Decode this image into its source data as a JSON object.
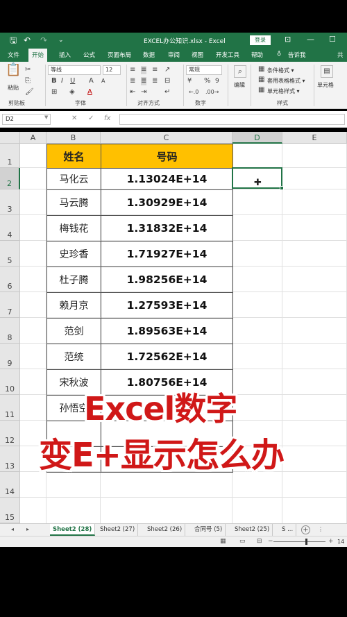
{
  "window": {
    "title": "EXCEL办公知识.xlsx  -  Excel",
    "login_label": "登录",
    "save_glyph": "🖫",
    "undo_glyph": "↶",
    "redo_glyph": "↷",
    "more_glyph": "⌄",
    "min_glyph": "—",
    "max_glyph": "☐",
    "ribbon_opt_glyph": "⊡"
  },
  "tabs": [
    "文件",
    "开始",
    "插入",
    "公式",
    "页面布局",
    "数据",
    "审阅",
    "视图",
    "开发工具",
    "帮助",
    "告诉我",
    "共"
  ],
  "ribbon": {
    "paste_label": "粘贴",
    "clipboard_label": "剪贴板",
    "font_name": "等线",
    "font_size": "12",
    "font_label": "字体",
    "align_label": "对齐方式",
    "number_format": "常规",
    "number_label": "数字",
    "cond_format": "条件格式 ▾",
    "table_format": "套用表格格式 ▾",
    "cell_style": "单元格样式 ▾",
    "styles_label": "样式",
    "edit_label": "编辑",
    "cells_label": "单元格",
    "bold": "B",
    "italic": "I",
    "underline": "U",
    "grow": "A",
    "shrink": "A",
    "fontcolor": "A",
    "percent": "%",
    "comma": "9",
    "currency": "¥"
  },
  "formula_bar": {
    "name_box": "D2",
    "fx": "fx",
    "cancel": "✕",
    "confirm": "✓",
    "formula": ""
  },
  "columns": [
    "A",
    "B",
    "C",
    "D",
    "E"
  ],
  "rows": [
    "1",
    "2",
    "3",
    "4",
    "5",
    "6",
    "7",
    "8",
    "9",
    "10",
    "11",
    "12",
    "13",
    "14",
    "15"
  ],
  "table": {
    "headers": [
      "姓名",
      "号码"
    ],
    "rows": [
      [
        "马化云",
        "1.13024E+14"
      ],
      [
        "马云腾",
        "1.30929E+14"
      ],
      [
        "梅钱花",
        "1.31832E+14"
      ],
      [
        "史珍香",
        "1.71927E+14"
      ],
      [
        "杜子腾",
        "1.98256E+14"
      ],
      [
        "赖月京",
        "1.27593E+14"
      ],
      [
        "范剑",
        "1.89563E+14"
      ],
      [
        "范统",
        "1.72562E+14"
      ],
      [
        "宋秋波",
        "1.80756E+14"
      ],
      [
        "孙悟空",
        ""
      ],
      [
        "",
        ""
      ],
      [
        "",
        ""
      ]
    ]
  },
  "selected_cell": "D2",
  "overlay": {
    "line1": "Excel数字",
    "line2": "变E+显示怎么办"
  },
  "sheets": [
    "Sheet2 (28)",
    "Sheet2 (27)",
    "Sheet2 (26)",
    "合同号 (5)",
    "Sheet2 (25)",
    "S ..."
  ],
  "active_sheet": "Sheet2 (28)",
  "status": {
    "zoom": "14",
    "add_sheet": "+",
    "prev": "◂",
    "next": "▸"
  }
}
